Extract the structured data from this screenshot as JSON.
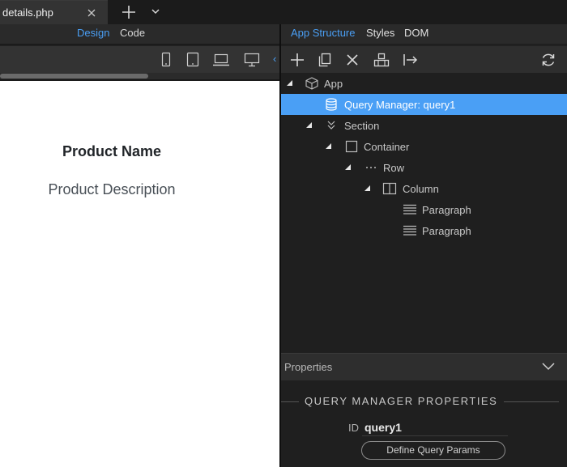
{
  "tabbar": {
    "file_name": "details.php",
    "close_icon": "close-icon",
    "new_tab_icon": "plus-icon",
    "menu_icon": "chevron-down-icon"
  },
  "left": {
    "view_modes": {
      "design": "Design",
      "code": "Code"
    },
    "active_view": "Design",
    "devices": [
      "phone-icon",
      "tablet-icon",
      "laptop-icon",
      "desktop-icon"
    ],
    "canvas": {
      "product_name": "Product Name",
      "product_description": "Product Description"
    }
  },
  "right": {
    "tabs": {
      "app_structure": "App Structure",
      "styles": "Styles",
      "dom": "DOM"
    },
    "active_tab": "App Structure",
    "toolbar": [
      "add-icon",
      "duplicate-icon",
      "delete-icon",
      "wrap-icon",
      "move-out-icon",
      "refresh-icon"
    ],
    "tree": [
      {
        "label": "App",
        "icon": "cube-icon",
        "expanded": true
      },
      {
        "label": "Query Manager: query1",
        "icon": "database-icon",
        "selected": true
      },
      {
        "label": "Section",
        "icon": "double-chevron-icon",
        "expanded": true
      },
      {
        "label": "Container",
        "icon": "square-icon",
        "expanded": true
      },
      {
        "label": "Row",
        "icon": "dots-icon",
        "expanded": true
      },
      {
        "label": "Column",
        "icon": "columns-icon",
        "expanded": true
      },
      {
        "label": "Paragraph",
        "icon": "paragraph-icon"
      },
      {
        "label": "Paragraph",
        "icon": "paragraph-icon"
      }
    ],
    "properties": {
      "header": "Properties",
      "section_title": "QUERY MANAGER PROPERTIES",
      "id_label": "ID",
      "id_value": "query1",
      "define_button": "Define Query Params"
    }
  },
  "colors": {
    "accent": "#4a9ff5",
    "selected_row": "#4a9ff5",
    "panel_bg": "#1f1f1f",
    "canvas_bg": "#ffffff"
  }
}
